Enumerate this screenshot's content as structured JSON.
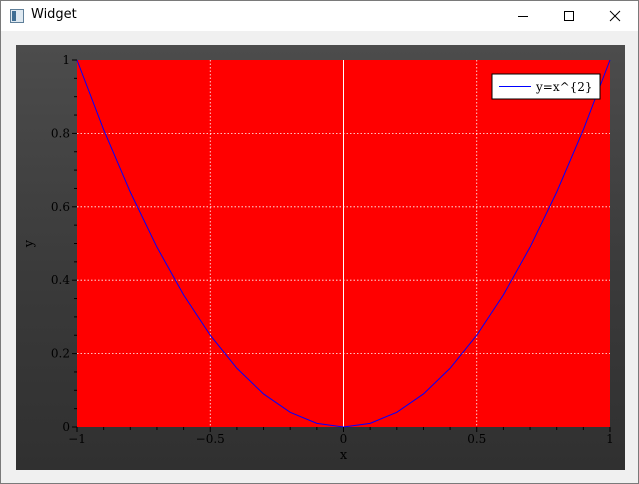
{
  "window": {
    "title": "Widget",
    "icon": "widget-app-icon",
    "controls": [
      "minimize-icon",
      "maximize-icon",
      "close-icon"
    ]
  },
  "chart_data": {
    "type": "line",
    "title": "",
    "xlabel": "x",
    "ylabel": "y",
    "xlim": [
      -1,
      1
    ],
    "ylim": [
      0,
      1
    ],
    "x_ticks": [
      -1,
      -0.5,
      0,
      0.5,
      1
    ],
    "x_tick_labels": [
      "−1",
      "−0.5",
      "0",
      "0.5",
      "1"
    ],
    "y_ticks": [
      0,
      0.2,
      0.4,
      0.6,
      0.8,
      1
    ],
    "y_tick_labels": [
      "0",
      "0.2",
      "0.4",
      "0.6",
      "0.8",
      "1"
    ],
    "grid": true,
    "legend_position": "top-right",
    "plot_background": "#ff0000",
    "outer_background": "#3c3c3c",
    "series": [
      {
        "name": "y=x^{2}",
        "color": "#0000ff",
        "x": [
          -1,
          -0.9,
          -0.8,
          -0.7,
          -0.6,
          -0.5,
          -0.4,
          -0.3,
          -0.2,
          -0.1,
          0,
          0.1,
          0.2,
          0.3,
          0.4,
          0.5,
          0.6,
          0.7,
          0.8,
          0.9,
          1
        ],
        "y": [
          1,
          0.81,
          0.64,
          0.49,
          0.36,
          0.25,
          0.16,
          0.09,
          0.04,
          0.01,
          0,
          0.01,
          0.04,
          0.09,
          0.16,
          0.25,
          0.36,
          0.49,
          0.64,
          0.81,
          1
        ]
      }
    ]
  }
}
